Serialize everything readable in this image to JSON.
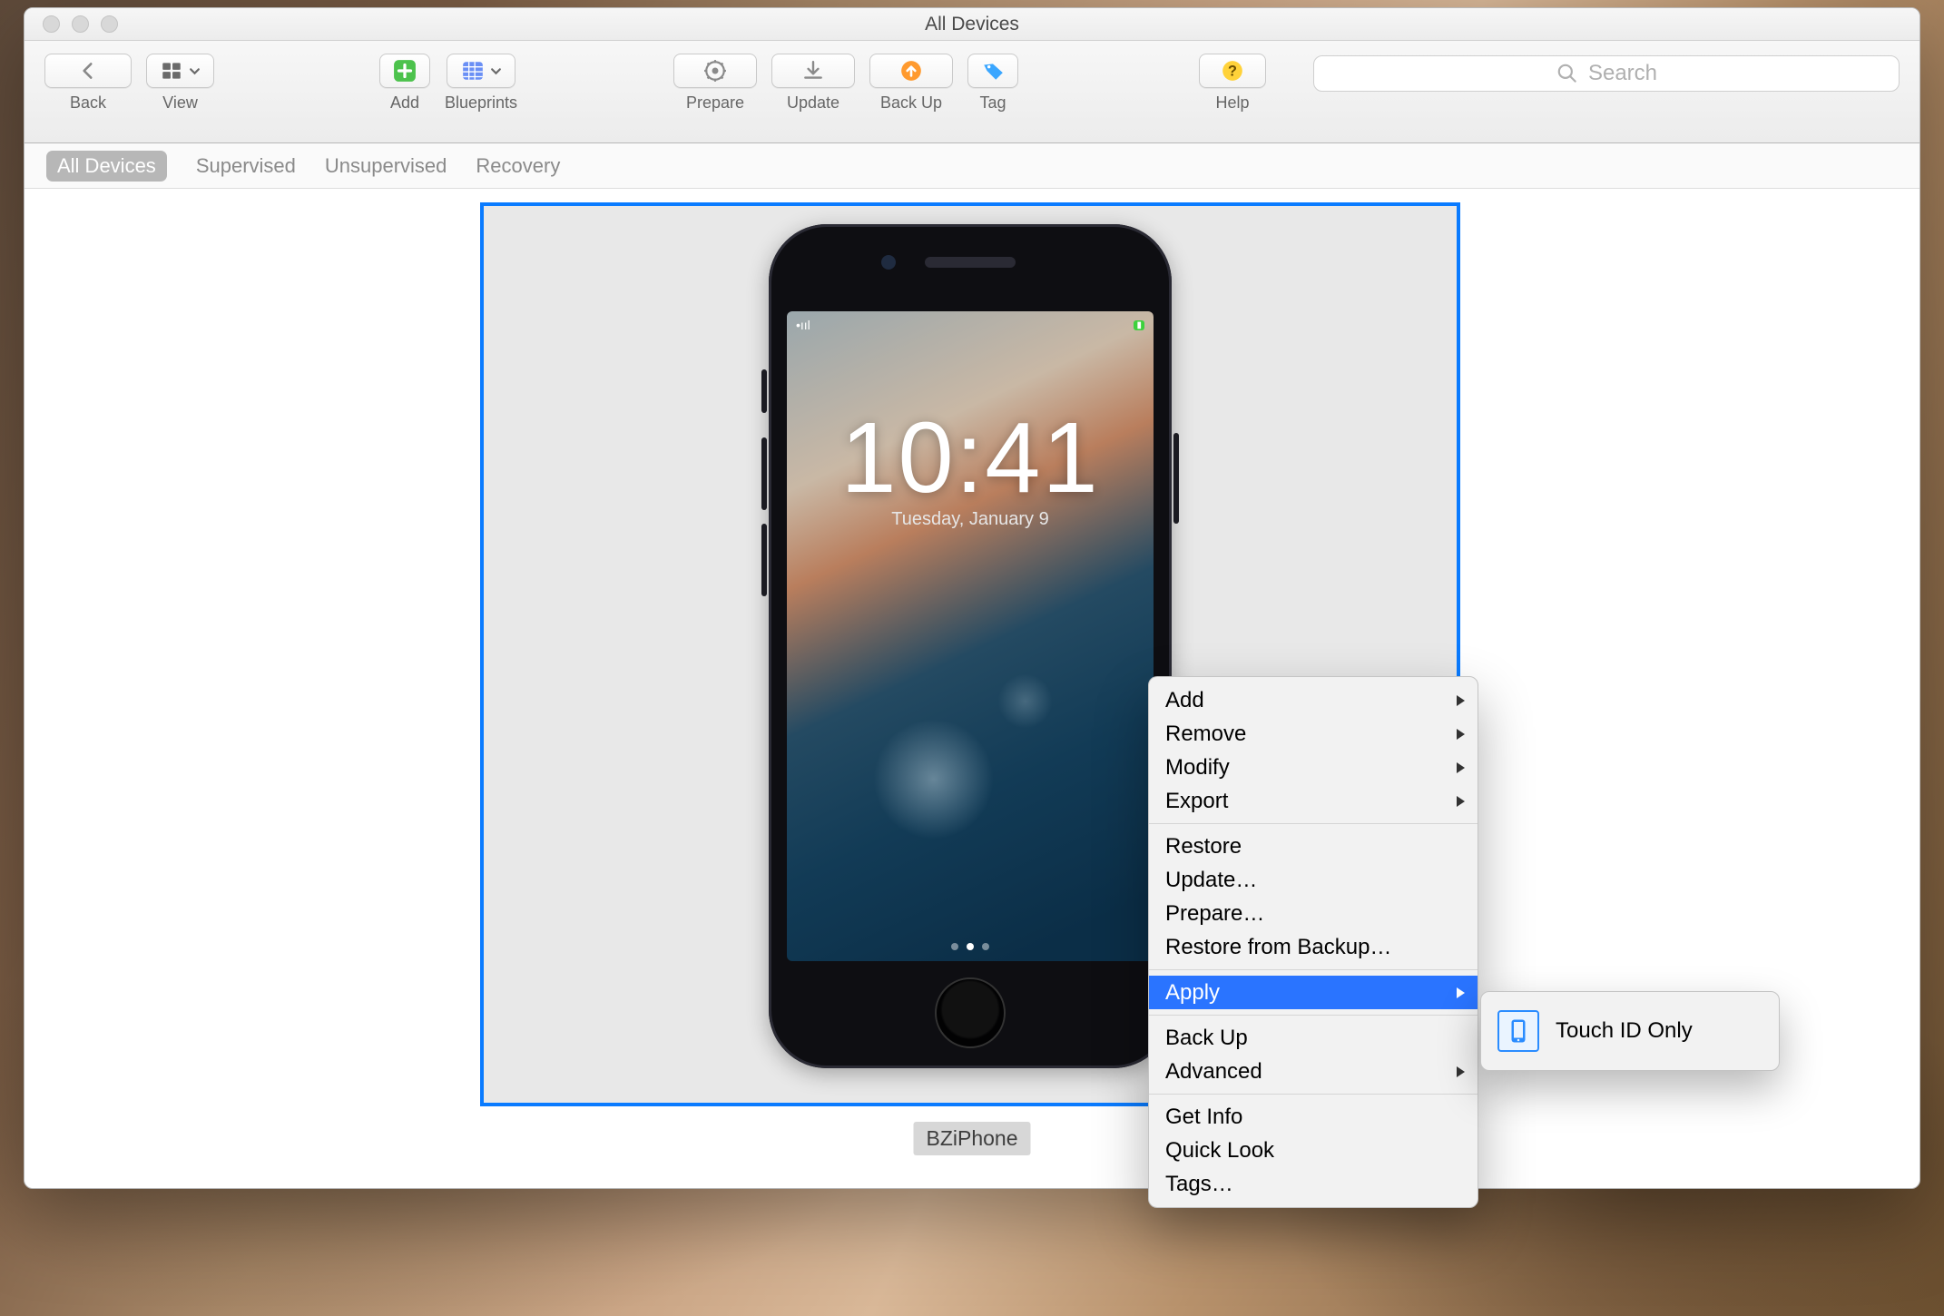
{
  "window": {
    "title": "All Devices"
  },
  "toolbar": {
    "back": "Back",
    "view": "View",
    "add": "Add",
    "blueprints": "Blueprints",
    "prepare": "Prepare",
    "update": "Update",
    "backup": "Back Up",
    "tag": "Tag",
    "help": "Help"
  },
  "search": {
    "placeholder": "Search"
  },
  "filters": {
    "all": "All Devices",
    "supervised": "Supervised",
    "unsupervised": "Unsupervised",
    "recovery": "Recovery"
  },
  "device": {
    "name": "BZiPhone",
    "lock_time": "10:41",
    "lock_date": "Tuesday, January 9"
  },
  "context_menu": {
    "add": "Add",
    "remove": "Remove",
    "modify": "Modify",
    "export": "Export",
    "restore": "Restore",
    "update": "Update…",
    "prepare": "Prepare…",
    "restore_backup": "Restore from Backup…",
    "apply": "Apply",
    "backup": "Back Up",
    "advanced": "Advanced",
    "get_info": "Get Info",
    "quick_look": "Quick Look",
    "tags": "Tags…"
  },
  "submenu": {
    "touch_id_only": "Touch ID Only"
  },
  "colors": {
    "selection": "#2a74ff",
    "accent": "#0a7bff"
  }
}
